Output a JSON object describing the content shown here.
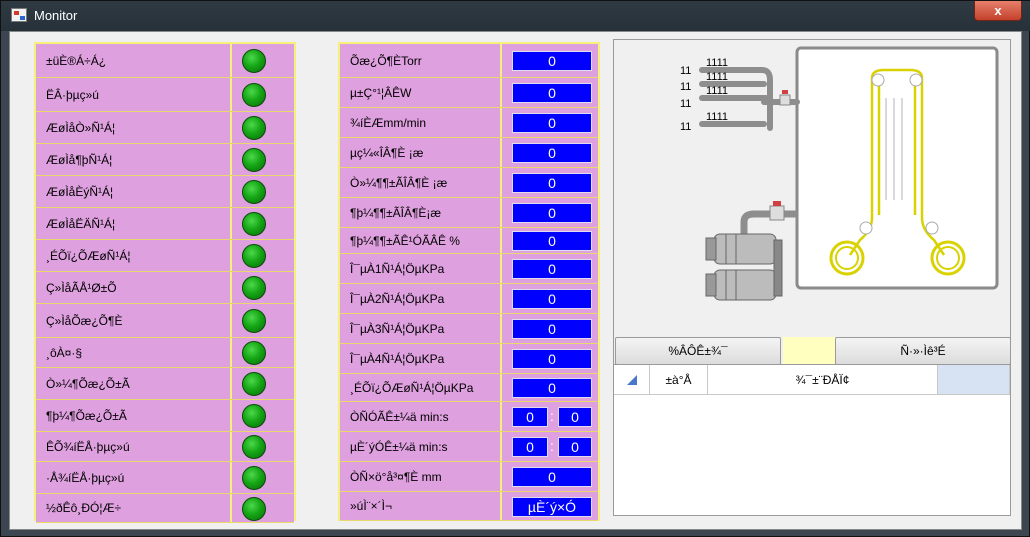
{
  "window": {
    "title": "Monitor",
    "close_label": "x"
  },
  "status_panel": {
    "items": [
      "±üÈ®Á÷Á¿",
      "ËÂ·þµç»ú",
      "ÆøÌåÒ»Ñ¹Á¦",
      "ÆøÌå¶þÑ¹Á¦",
      "ÆøÌåÈýÑ¹Á¦",
      "ÆøÌåËÄÑ¹Á¦",
      "¸ÉÕï¿ÕÆøÑ¹Á¦",
      "Ç»ÌåÃÅ¹Ø±Õ",
      "Ç»ÌåÕæ¿Õ¶È",
      "¸ôÀ¤·§",
      "Ò»¼¶Õæ¿Õ±Ã",
      "¶þ¼¶Õæ¿Õ±Ã",
      "ÊÕ¾íËÅ·þµç»ú",
      "·Å¾íËÅ·þµç»ú",
      "½ðÊô¸ÐÓ¦Æ÷"
    ]
  },
  "values_panel": {
    "rows": [
      {
        "label": "Õæ¿Õ¶ÈTorr",
        "value": "0"
      },
      {
        "label": "µ±Ç°¹¦ÂÊW",
        "value": "0"
      },
      {
        "label": "¾íÈÆmm/min",
        "value": "0"
      },
      {
        "label": "µç¼«ÎÂ¶È ¡æ",
        "value": "0"
      },
      {
        "label": "Ò»¼¶¶±ÃÎÂ¶È ¡æ",
        "value": "0"
      },
      {
        "label": "¶þ¼¶¶±ÃÎÂ¶È¡æ",
        "value": "0"
      },
      {
        "label": "¶þ¼¶¶±ÃÊ¹ÓÃÂÊ %",
        "value": "0"
      },
      {
        "label": "Î¯µÀ1Ñ¹Á¦ÖµKPa",
        "value": "0"
      },
      {
        "label": "Î¯µÀ2Ñ¹Á¦ÖµKPa",
        "value": "0"
      },
      {
        "label": "Î¯µÀ3Ñ¹Á¦ÖµKPa",
        "value": "0"
      },
      {
        "label": "Î¯µÀ4Ñ¹Á¦ÖµKPa",
        "value": "0"
      },
      {
        "label": "¸ÉÕï¿ÕÆøÑ¹Á¦ÖµKPa",
        "value": "0"
      },
      {
        "label": "ÒÑÓÃÊ±¼ä min:s",
        "min": "0",
        "sec": "0",
        "sep": ":"
      },
      {
        "label": "µÈ´ýÓÊ±¼ä min:s",
        "min": "0",
        "sec": "0",
        "sep": ":"
      },
      {
        "label": "ÒÑ×ö°å³¤¶È mm",
        "value": "0"
      },
      {
        "label": "»úÌ¨×´Ì¬",
        "value": "µÈ´ý×Ó"
      }
    ]
  },
  "diagram": {
    "channels": [
      {
        "num": "11",
        "value": "1111"
      },
      {
        "num": "11",
        "value": "1111"
      },
      {
        "num": "11",
        "value": "1111"
      },
      {
        "num": "11",
        "value": "1111"
      }
    ]
  },
  "buttons": {
    "left": "%ÂÔÊ±¾¯",
    "right": "Ñ·»·Ìê³É"
  },
  "table": {
    "col1": "±à°Å",
    "col2": "¾¯±¨ÐÅÏ¢"
  },
  "colors": {
    "panel_bg": "#dea0de",
    "grid": "#f5f07c",
    "value_bg": "#0000ff",
    "led_on": "#15a715",
    "coil": "#d9d200"
  }
}
